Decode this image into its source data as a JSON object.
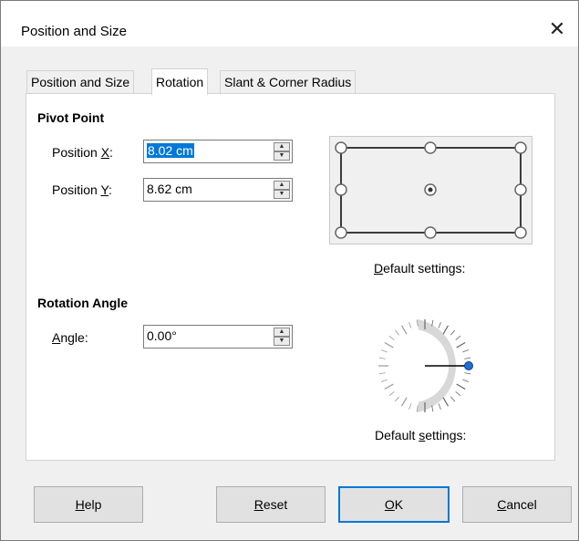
{
  "window": {
    "title": "Position and Size",
    "close_glyph": "✕"
  },
  "tabs": [
    {
      "label": "Position and Size",
      "active": false
    },
    {
      "label": "Rotation",
      "active": true
    },
    {
      "label": "Slant & Corner Radius",
      "active": false
    }
  ],
  "pivot": {
    "heading": "Pivot Point",
    "pos_x_label_pre": "Position ",
    "pos_x_label_key": "X",
    "pos_x_label_post": ":",
    "pos_x_value": "8.02 cm",
    "pos_y_label_pre": "Position ",
    "pos_y_label_key": "Y",
    "pos_y_label_post": ":",
    "pos_y_value": "8.62 cm",
    "default_caption_key": "D",
    "default_caption_rest": "efault settings:",
    "selected_point": "center"
  },
  "rotation": {
    "heading": "Rotation Angle",
    "angle_label_key": "A",
    "angle_label_rest": "ngle:",
    "angle_value": "0.00°",
    "angle_degrees": 0,
    "default_caption_pre": "Default ",
    "default_caption_key": "s",
    "default_caption_rest": "ettings:"
  },
  "buttons": {
    "help_key": "H",
    "help_rest": "elp",
    "reset_key": "R",
    "reset_rest": "eset",
    "ok_key": "O",
    "ok_rest": "K",
    "cancel_key": "C",
    "cancel_rest": "ancel"
  },
  "colors": {
    "accent": "#0078d7",
    "selection": "#0078d7"
  }
}
